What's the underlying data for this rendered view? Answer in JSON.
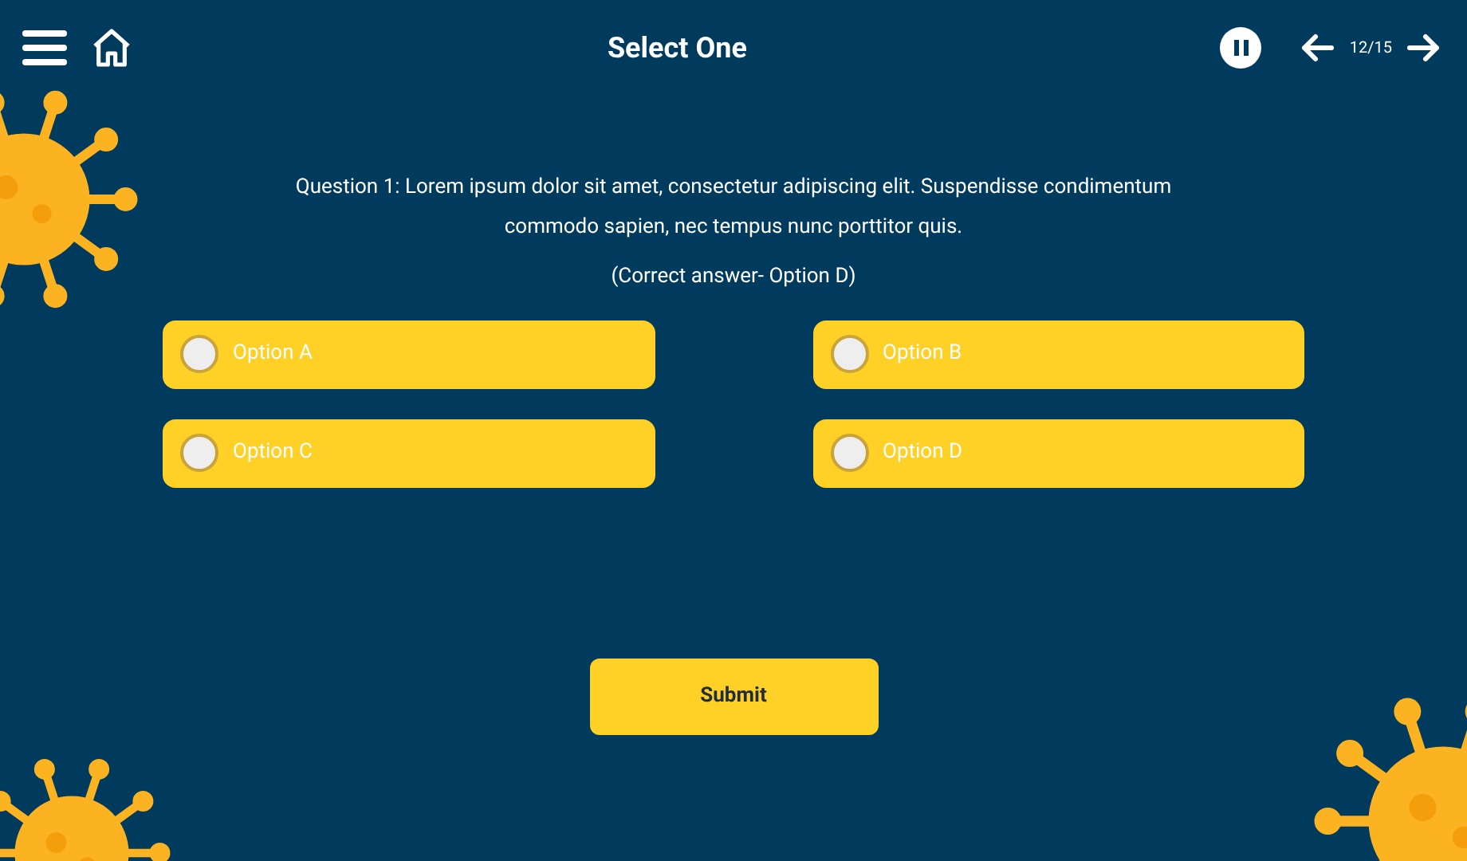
{
  "header": {
    "title": "Select One",
    "progress": "12/15"
  },
  "question": {
    "text": "Question 1:  Lorem ipsum dolor sit amet, consectetur adipiscing elit. Suspendisse condimentum commodo sapien, nec tempus nunc porttitor quis.",
    "hint": "(Correct answer- Option D)"
  },
  "options": [
    {
      "label": "Option A",
      "selected": false
    },
    {
      "label": "Option B",
      "selected": false
    },
    {
      "label": "Option C",
      "selected": false
    },
    {
      "label": "Option D",
      "selected": false
    }
  ],
  "submit": "Submit"
}
